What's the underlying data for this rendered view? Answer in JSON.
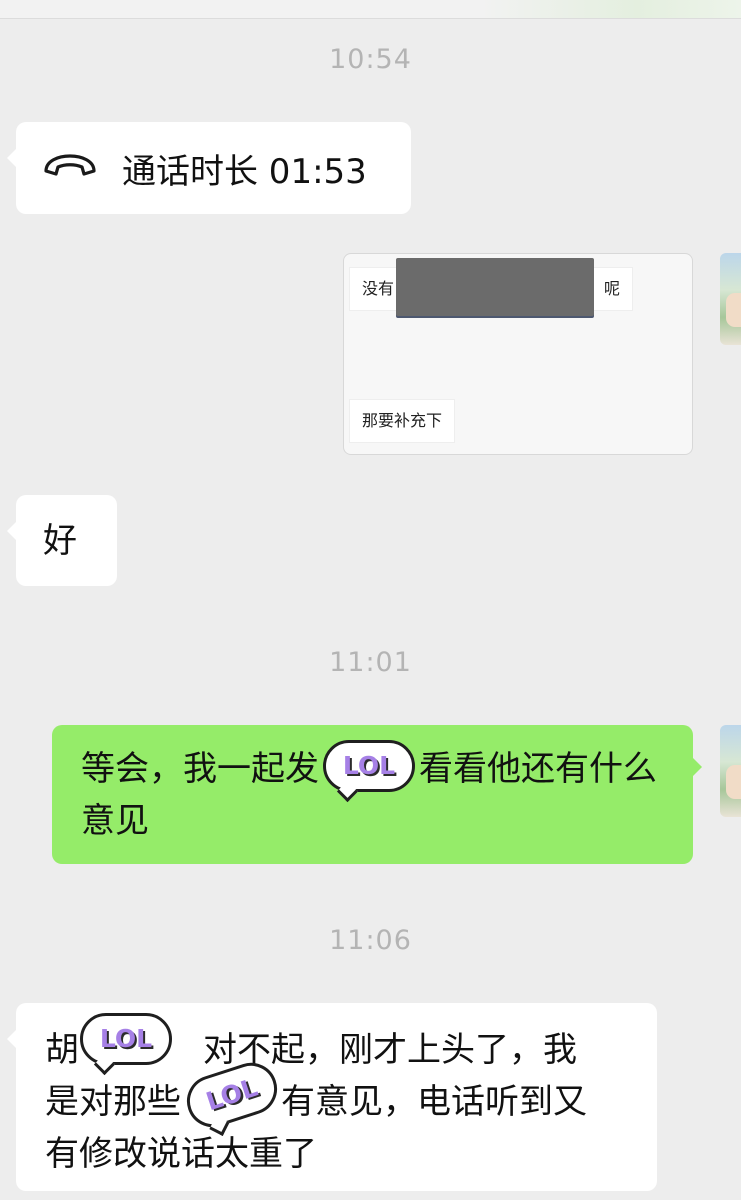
{
  "timestamps": [
    "10:54",
    "11:01",
    "11:06"
  ],
  "call_record": {
    "icon": "phone-hangup-icon",
    "label": "通话时长 01:53"
  },
  "shared_image": {
    "top_snippet_prefix": "没有",
    "top_snippet_suffix": "呢",
    "bottom_snippet": "那要补充下"
  },
  "messages": {
    "ok": "好",
    "outgoing_before_sticker": "等会，我一起发",
    "outgoing_after_sticker": "看看他还有什么意见",
    "incoming_line1_start": "胡",
    "incoming_line1_end": "对不起，刚才上头了，我",
    "incoming_line2_start": "是对那些",
    "incoming_line2_end": "有意见，电话听到又",
    "incoming_line3": "有修改说话太重了"
  },
  "sticker": {
    "text": "LOL",
    "icon": "lol-sticker-icon"
  },
  "colors": {
    "background": "#ededed",
    "incoming_bubble": "#ffffff",
    "outgoing_bubble": "#95ec69",
    "timestamp": "#b4b4b4",
    "sticker_text": "#a680e6"
  }
}
